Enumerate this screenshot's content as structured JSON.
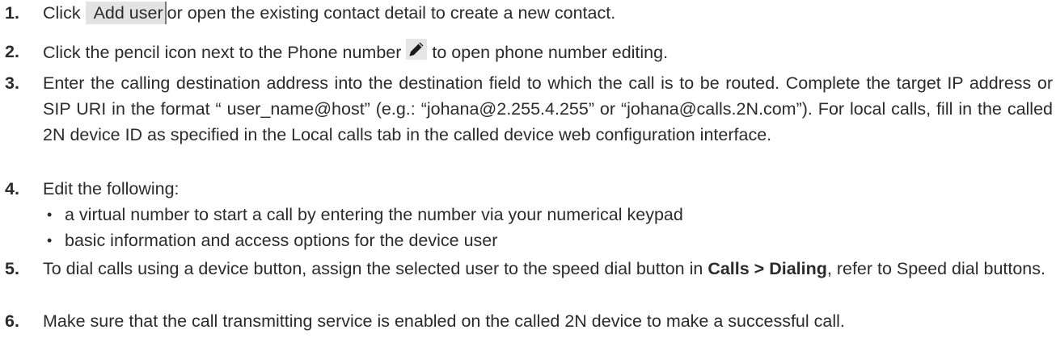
{
  "steps": [
    {
      "number": "1.",
      "before": "Click ",
      "button_label": "Add user",
      "after": "or open the existing contact detail to create a new contact."
    },
    {
      "number": "2.",
      "before": "Click the pencil icon next to the Phone number",
      "icon": "pencil-icon",
      "after": "to open phone number editing."
    },
    {
      "number": "3.",
      "text": "Enter the calling destination address into the destination field to which the call is to be routed. Complete the target IP address or SIP URI in the format “ user_name@host” (e.g.: “johana@2.255.4.255” or “johana@calls.2N.com”). For local calls, fill in the called 2N device ID as specified in the Local calls tab in the called device web configuration interface."
    },
    {
      "number": "4.",
      "text": "Edit the following:",
      "bullets": [
        "a virtual number to start a call by entering the number via your numerical keypad",
        "basic information and access options for the device user"
      ]
    },
    {
      "number": "5.",
      "before": "To dial calls using a device button, assign the selected user to the speed dial button in ",
      "bold": "Calls > Dialing",
      "after": ", refer to Speed dial buttons."
    },
    {
      "number": "6.",
      "text": "Make sure that the call transmitting service is enabled on the called 2N device to make a successful call."
    }
  ],
  "colors": {
    "text": "#2b2b2b",
    "button_bg": "#e3e3e3",
    "button_border": "#777777"
  }
}
